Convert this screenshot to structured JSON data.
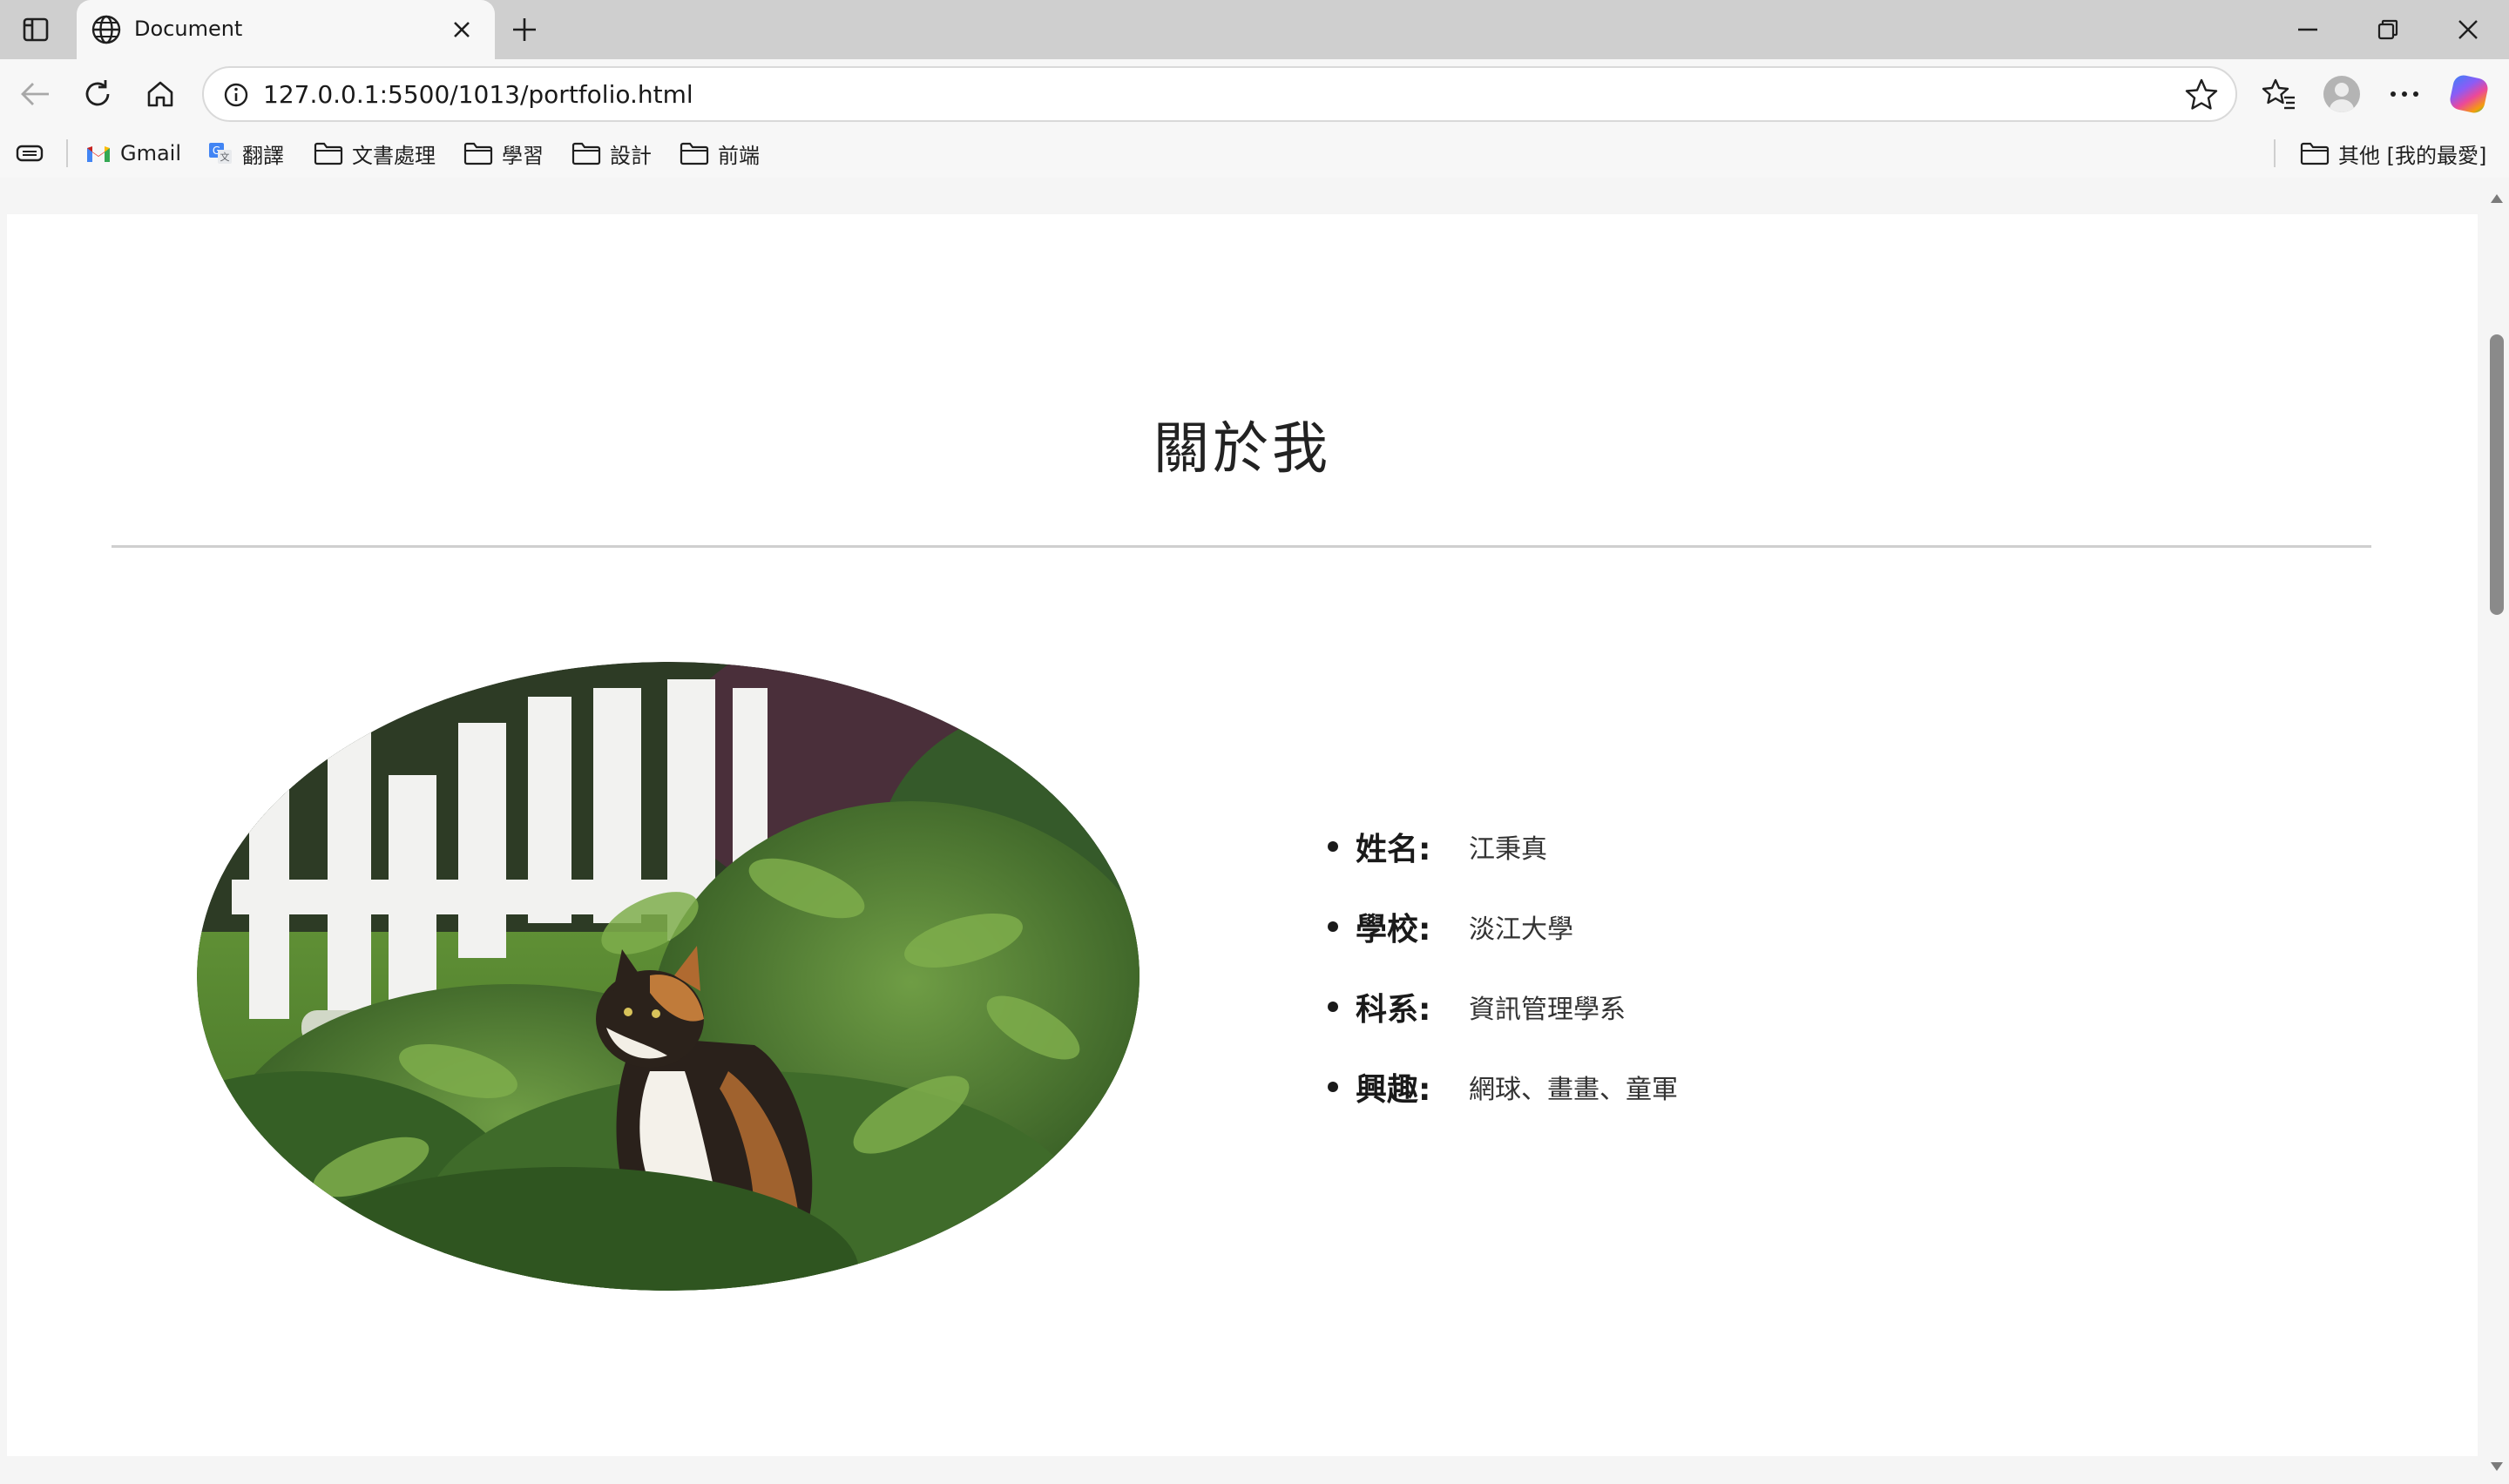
{
  "browser": {
    "tab_title": "Document",
    "url": "127.0.0.1:5500/1013/portfolio.html",
    "bookmarks": [
      {
        "label": "Gmail",
        "icon": "gmail-icon"
      },
      {
        "label": "翻譯",
        "icon": "translate-icon"
      },
      {
        "label": "文書處理",
        "icon": "folder-icon"
      },
      {
        "label": "學習",
        "icon": "folder-icon"
      },
      {
        "label": "設計",
        "icon": "folder-icon"
      },
      {
        "label": "前端",
        "icon": "folder-icon"
      }
    ],
    "other_bookmarks": "其他 [我的最愛]"
  },
  "page": {
    "heading": "關於我",
    "photo_alt": "calico-cat-in-bushes",
    "info": [
      {
        "key": "姓名:",
        "value": "江秉真"
      },
      {
        "key": "學校:",
        "value": "淡江大學"
      },
      {
        "key": "科系:",
        "value": "資訊管理學系"
      },
      {
        "key": "興趣:",
        "value": "網球、畫畫、童軍"
      }
    ]
  }
}
